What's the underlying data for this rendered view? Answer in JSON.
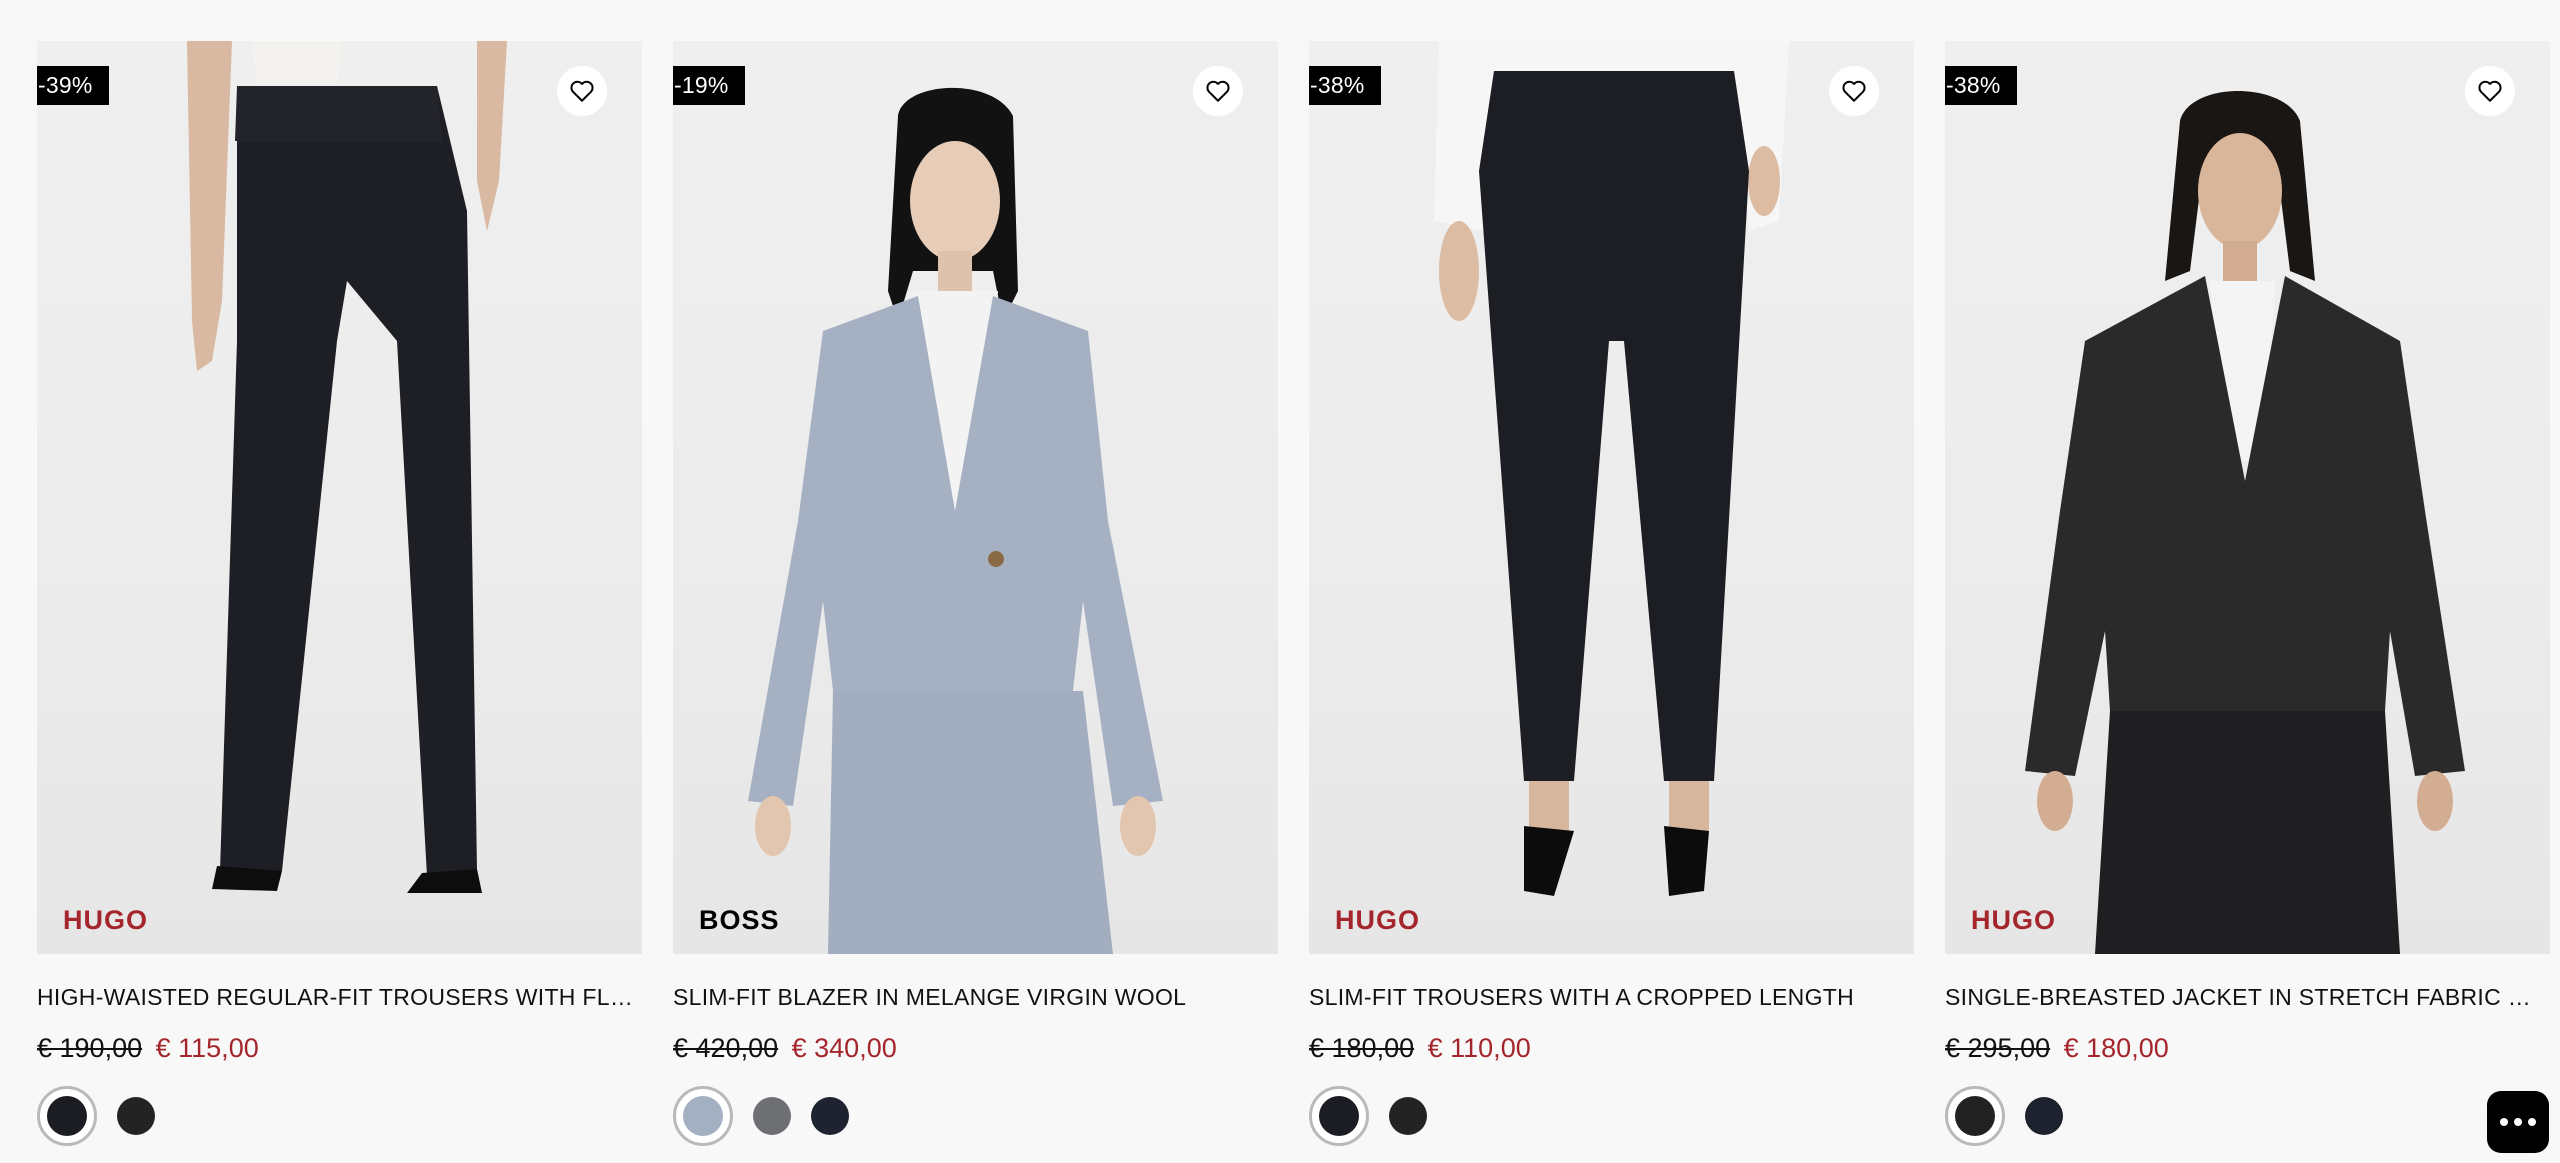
{
  "products": [
    {
      "discount": "-39%",
      "brand": "HUGO",
      "title": "HIGH-WAISTED REGULAR-FIT TROUSERS WITH FLARED...",
      "old_price": "€ 190,00",
      "new_price": "€ 115,00",
      "swatches": [
        "#1c1d22",
        "#232323"
      ]
    },
    {
      "discount": "-19%",
      "brand": "BOSS",
      "title": "SLIM-FIT BLAZER IN MELANGE VIRGIN WOOL",
      "old_price": "€ 420,00",
      "new_price": "€ 340,00",
      "swatches": [
        "#a3b0c2",
        "#6e6f72",
        "#1f2230"
      ]
    },
    {
      "discount": "-38%",
      "brand": "HUGO",
      "title": "SLIM-FIT TROUSERS WITH A CROPPED LENGTH",
      "old_price": "€ 180,00",
      "new_price": "€ 110,00",
      "swatches": [
        "#1c1d24",
        "#232323"
      ]
    },
    {
      "discount": "-38%",
      "brand": "HUGO",
      "title": "SINGLE-BREASTED JACKET IN STRETCH FABRIC WITH N...",
      "old_price": "€ 295,00",
      "new_price": "€ 180,00",
      "swatches": [
        "#222222",
        "#1e2130"
      ]
    }
  ],
  "colors": {
    "accent_red": "#a4262c",
    "background": "#f8f8f8"
  },
  "icons": {
    "favorite": "heart-outline-icon",
    "chat": "chat-dots-icon"
  }
}
